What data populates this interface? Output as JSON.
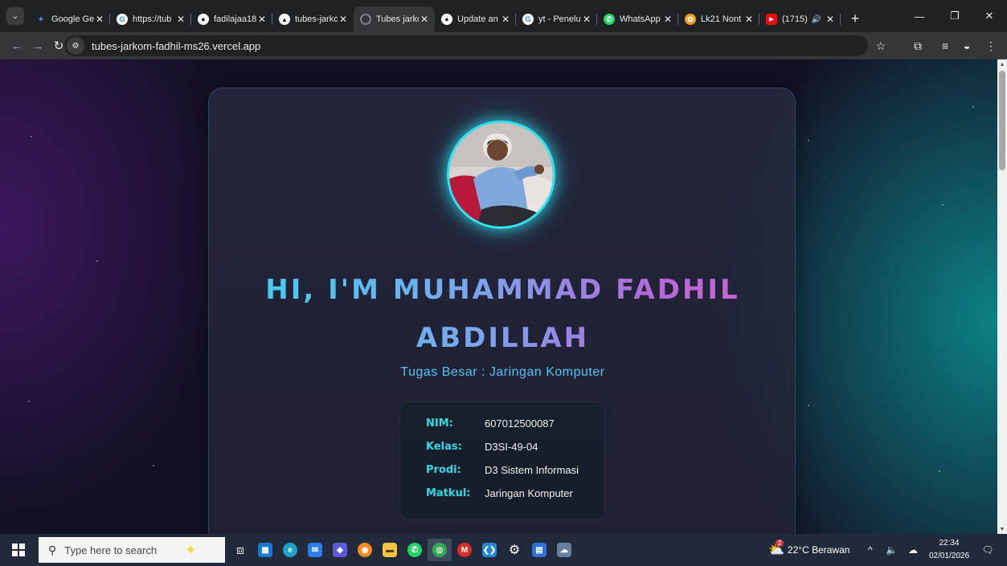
{
  "browser": {
    "tabs": [
      {
        "title": "Google Ge",
        "favicon": "gemini-icon",
        "color": "#4f8df7",
        "glyph": "✦"
      },
      {
        "title": "https://tub",
        "favicon": "google-icon",
        "color": "#ffffff",
        "glyph": "G"
      },
      {
        "title": "fadilajaa18",
        "favicon": "github-icon",
        "color": "#ffffff",
        "glyph": "●"
      },
      {
        "title": "tubes-jarko",
        "favicon": "vercel-icon",
        "color": "#ffffff",
        "glyph": "▲"
      },
      {
        "title": "Tubes jarko",
        "favicon": "loading-icon",
        "color": "#9aa0a6",
        "glyph": "◌",
        "active": true
      },
      {
        "title": "Update an",
        "favicon": "github-icon",
        "color": "#ffffff",
        "glyph": "●"
      },
      {
        "title": "yt - Penelu",
        "favicon": "google-icon",
        "color": "#ffffff",
        "glyph": "G"
      },
      {
        "title": "WhatsApp",
        "favicon": "whatsapp-icon",
        "color": "#25d366",
        "glyph": "✆"
      },
      {
        "title": "Lk21 Nont",
        "favicon": "lk21-icon",
        "color": "#f4a020",
        "glyph": "✿"
      },
      {
        "title": "(1715)",
        "favicon": "youtube-icon",
        "color": "#ff0000",
        "glyph": "▶",
        "audio": "🔊"
      }
    ],
    "address": "tubes-jarkom-fadhil-ms26.vercel.app"
  },
  "page": {
    "heading_line1_a": "HI, I'M MUHAMMAD ",
    "heading_line1_b": "FADHIL",
    "heading_line2": "ABDILLAH",
    "subtitle": "Tugas Besar : Jaringan Komputer",
    "info": [
      {
        "key": "NIM:",
        "value": "607012500087"
      },
      {
        "key": "Kelas:",
        "value": "D3SI-49-04"
      },
      {
        "key": "Prodi:",
        "value": "D3 Sistem Informasi"
      },
      {
        "key": "Matkul:",
        "value": "Jaringan Komputer"
      }
    ]
  },
  "taskbar": {
    "search_placeholder": "Type here to search",
    "weather": "22°C Berawan",
    "weather_badge": "2",
    "time": "22:34",
    "date": "02/01/2026"
  },
  "colors": {
    "accent_cyan": "#2fe3f0",
    "heading_start": "#38d7f2",
    "heading_end": "#d85fd4",
    "info_key": "#34d7e6"
  }
}
